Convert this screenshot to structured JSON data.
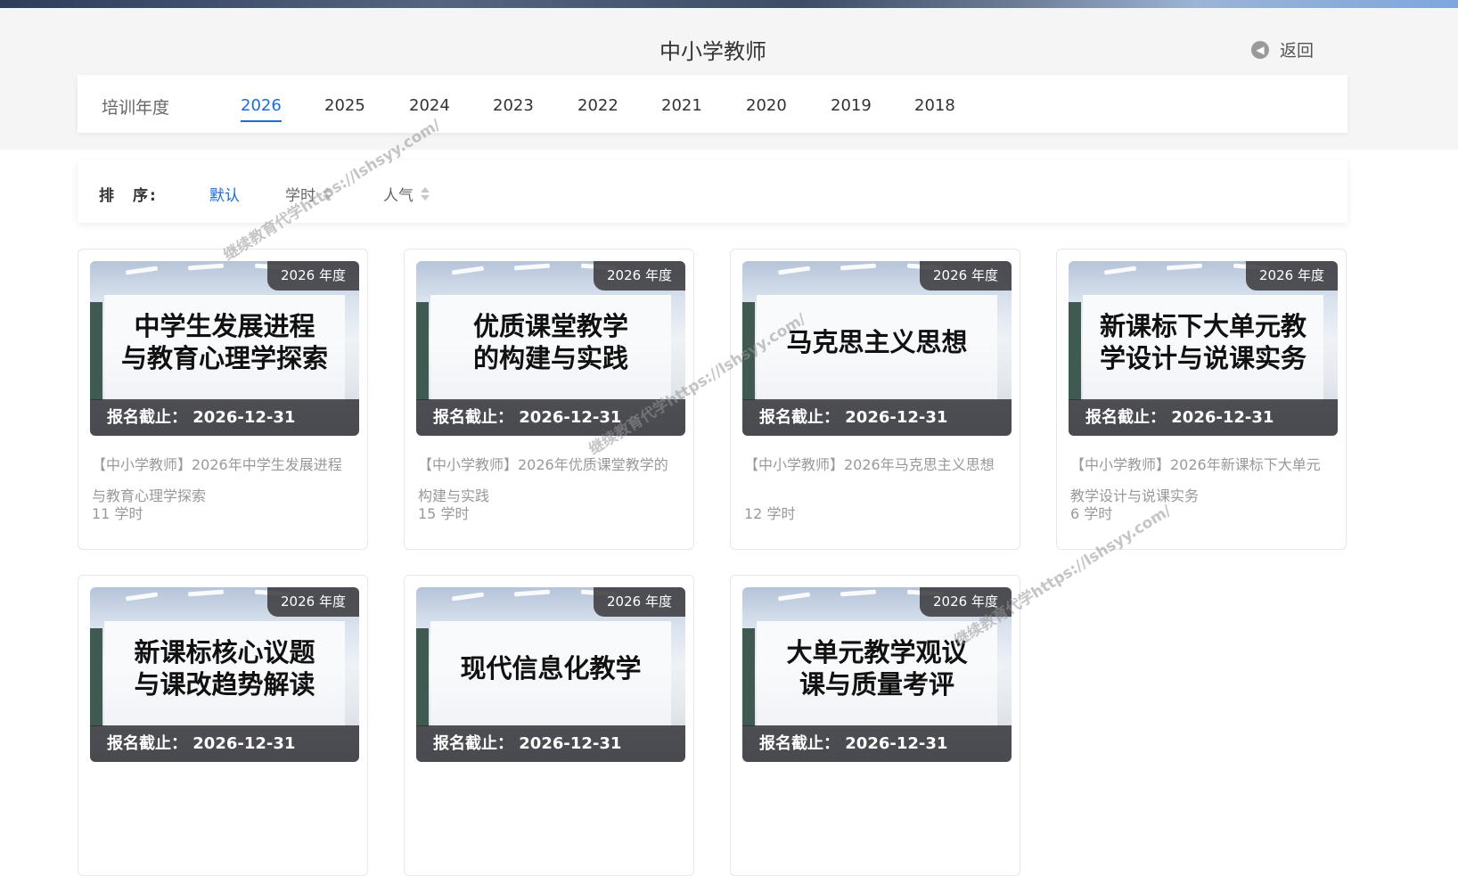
{
  "header": {
    "title": "中小学教师",
    "back_label": "返回",
    "back_icon": "arrow-left-circle-icon"
  },
  "years": {
    "label": "培训年度",
    "items": [
      "2026",
      "2025",
      "2024",
      "2023",
      "2022",
      "2021",
      "2020",
      "2019",
      "2018"
    ],
    "active": "2026"
  },
  "sort": {
    "label": "排　序:",
    "items": [
      "默认",
      "学时",
      "人气"
    ],
    "active": "默认"
  },
  "courses": [
    {
      "year_tag": "2026 年度",
      "thumb_title_1": "中学生发展进程",
      "thumb_title_2": "与教育心理学探索",
      "deadline": "报名截止： 2026-12-31",
      "desc": "【中小学教师】2026年中学生发展进程与教育心理学探索",
      "hours": "11 学时"
    },
    {
      "year_tag": "2026 年度",
      "thumb_title_1": "优质课堂教学",
      "thumb_title_2": "的构建与实践",
      "deadline": "报名截止： 2026-12-31",
      "desc": "【中小学教师】2026年优质课堂教学的构建与实践",
      "hours": "15 学时"
    },
    {
      "year_tag": "2026 年度",
      "thumb_title_1": "马克思主义思想",
      "thumb_title_2": "",
      "deadline": "报名截止： 2026-12-31",
      "desc": "【中小学教师】2026年马克思主义思想",
      "hours": "12 学时"
    },
    {
      "year_tag": "2026 年度",
      "thumb_title_1": "新课标下大单元教",
      "thumb_title_2": "学设计与说课实务",
      "deadline": "报名截止： 2026-12-31",
      "desc": "【中小学教师】2026年新课标下大单元教学设计与说课实务",
      "hours": "6 学时"
    },
    {
      "year_tag": "2026 年度",
      "thumb_title_1": "新课标核心议题",
      "thumb_title_2": "与课改趋势解读",
      "deadline": "报名截止： 2026-12-31",
      "desc": "",
      "hours": ""
    },
    {
      "year_tag": "2026 年度",
      "thumb_title_1": "现代信息化教学",
      "thumb_title_2": "",
      "deadline": "报名截止： 2026-12-31",
      "desc": "",
      "hours": ""
    },
    {
      "year_tag": "2026 年度",
      "thumb_title_1": "大单元教学观议",
      "thumb_title_2": "课与质量考评",
      "deadline": "报名截止： 2026-12-31",
      "desc": "",
      "hours": ""
    }
  ],
  "watermark_text": "继续教育代学https://lshsyy.com/"
}
